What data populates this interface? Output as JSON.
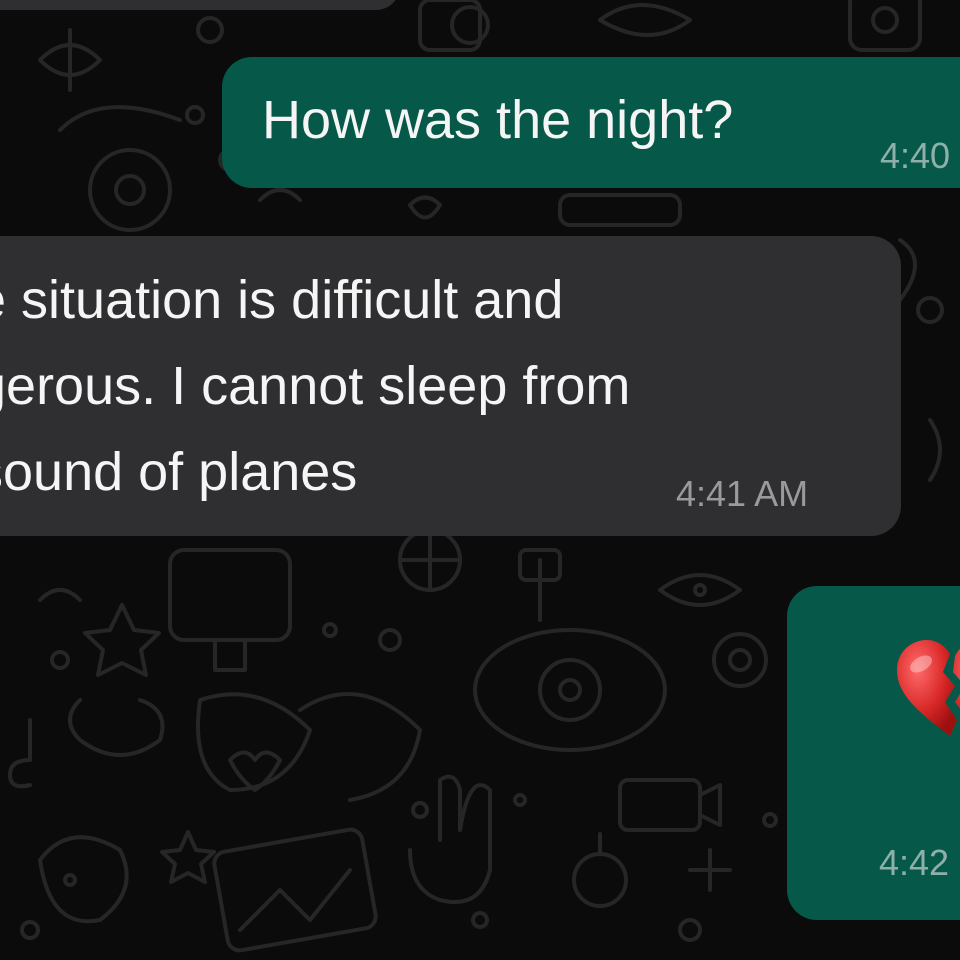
{
  "messages": [
    {
      "direction": "outgoing",
      "text": "How was the night?",
      "time": "4:40"
    },
    {
      "direction": "incoming",
      "lines": [
        "e situation is difficult and",
        "gerous. I cannot sleep from",
        " sound of planes"
      ],
      "time": "4:41 AM"
    },
    {
      "direction": "outgoing",
      "emoji": "broken-heart-icon",
      "time": "4:42"
    }
  ],
  "colors": {
    "background": "#0b0b0b",
    "outgoing_bubble": "#065949",
    "incoming_bubble": "#2f2f31",
    "text": "#f5f5f5",
    "outgoing_time": "#8fb0a9",
    "incoming_time": "#9a9a9e",
    "wallpaper_doodle": "#262626"
  }
}
